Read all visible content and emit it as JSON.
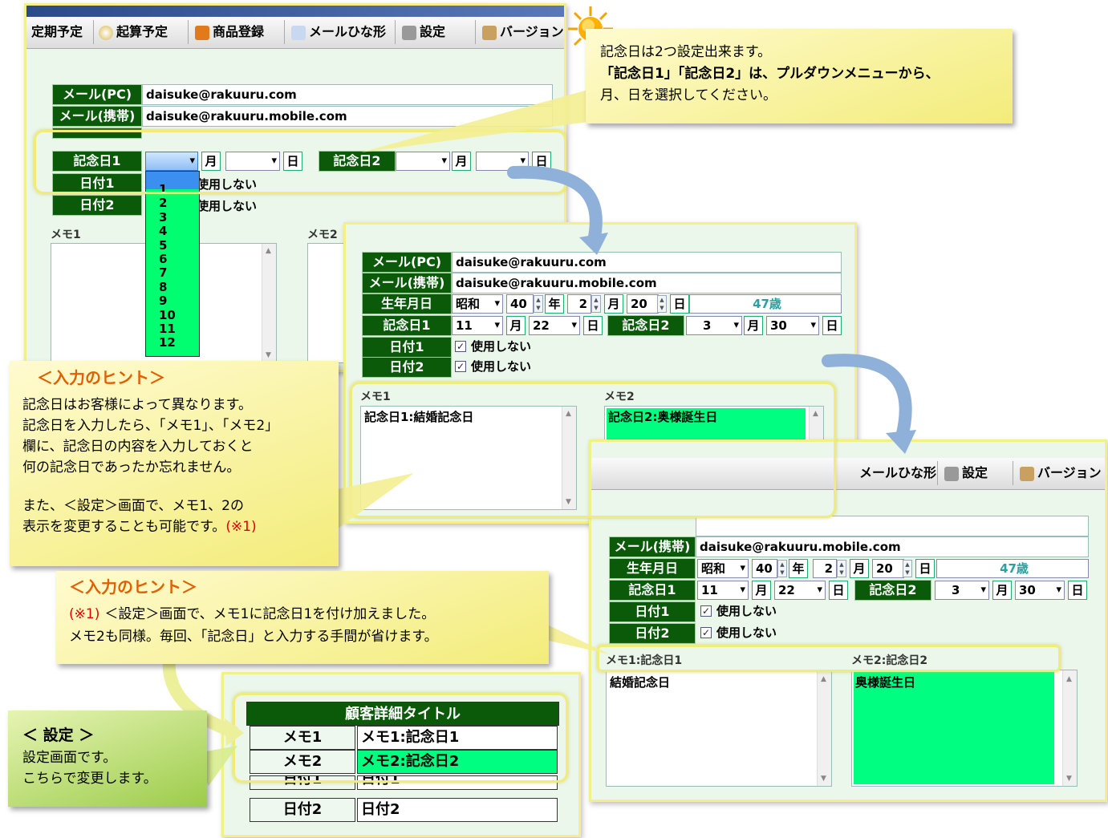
{
  "toolbar": {
    "items": [
      "定期予定",
      "起算予定",
      "商品登録",
      "メールひな形",
      "設定",
      "バージョン"
    ],
    "items_partial": [
      "メールひな形",
      "設定",
      "バージョン"
    ]
  },
  "form": {
    "mail_pc_label": "メール(PC)",
    "mail_pc_value": "daisuke@rakuuru.com",
    "mail_mobile_label": "メール(携帯)",
    "mail_mobile_value": "daisuke@rakuuru.mobile.com",
    "birthday_label": "生年月日",
    "era": "昭和",
    "year": "40",
    "year_unit": "年",
    "month": "2",
    "month_unit": "月",
    "day": "20",
    "day_unit": "日",
    "age": "47歳",
    "anniv1_label": "記念日1",
    "anniv2_label": "記念日2",
    "anniv1_month": "11",
    "anniv1_day": "22",
    "anniv2_month": "3",
    "anniv2_day": "30",
    "date1_label": "日付1",
    "date2_label": "日付2",
    "unused_label": "使用しない",
    "memo1_label": "メモ1",
    "memo2_label": "メモ2",
    "memo1_text": "記念日1:結婚記念日",
    "memo2_text": "記念日2:奥様誕生日",
    "memo1_label_changed": "メモ1:記念日1",
    "memo2_label_changed": "メモ2:記念日2",
    "memo1_text_changed": "結婚記念日",
    "memo2_text_changed": "奥様誕生日",
    "dropdown_options": [
      "1",
      "2",
      "3",
      "4",
      "5",
      "6",
      "7",
      "8",
      "9",
      "10",
      "11",
      "12"
    ]
  },
  "settings": {
    "title": "顧客詳細タイトル",
    "rows": [
      {
        "label": "メモ1",
        "value": "メモ1:記念日1"
      },
      {
        "label": "メモ2",
        "value": "メモ2:記念日2"
      },
      {
        "label": "日付1",
        "value": "日付1"
      },
      {
        "label": "日付2",
        "value": "日付2"
      }
    ]
  },
  "callouts": {
    "top_line1": "記念日は2つ設定出来ます。",
    "top_line2": "「記念日1」「記念日2」は、プルダウンメニューから、",
    "top_line3": "月、日を選択してください。",
    "hint1_title": "＜入力のヒント＞",
    "hint1_line1": "記念日はお客様によって異なります。",
    "hint1_line2": "記念日を入力したら、「メモ1」、「メモ2」",
    "hint1_line3": "欄に、記念日の内容を入力しておくと",
    "hint1_line4": "何の記念日であったか忘れません。",
    "hint1_line5": "また、＜設定＞画面で、メモ1、2の",
    "hint1_line6": "表示を変更することも可能です。",
    "hint1_note": "(※1)",
    "hint2_title": "＜入力のヒント＞",
    "hint2_note": "(※1)",
    "hint2_line1": "＜設定＞画面で、メモ1に記念日1を付け加えました。",
    "hint2_line2": "メモ2も同様。毎回、「記念日」と入力する手間が省けます。",
    "set_title": "＜ 設定 ＞",
    "set_line1": "設定画面です。",
    "set_line2": "こちらで変更します。"
  },
  "colors": {
    "accent_green": "#0a5a0a",
    "highlight": "#00ff80",
    "callout": "#f3ec7a"
  }
}
